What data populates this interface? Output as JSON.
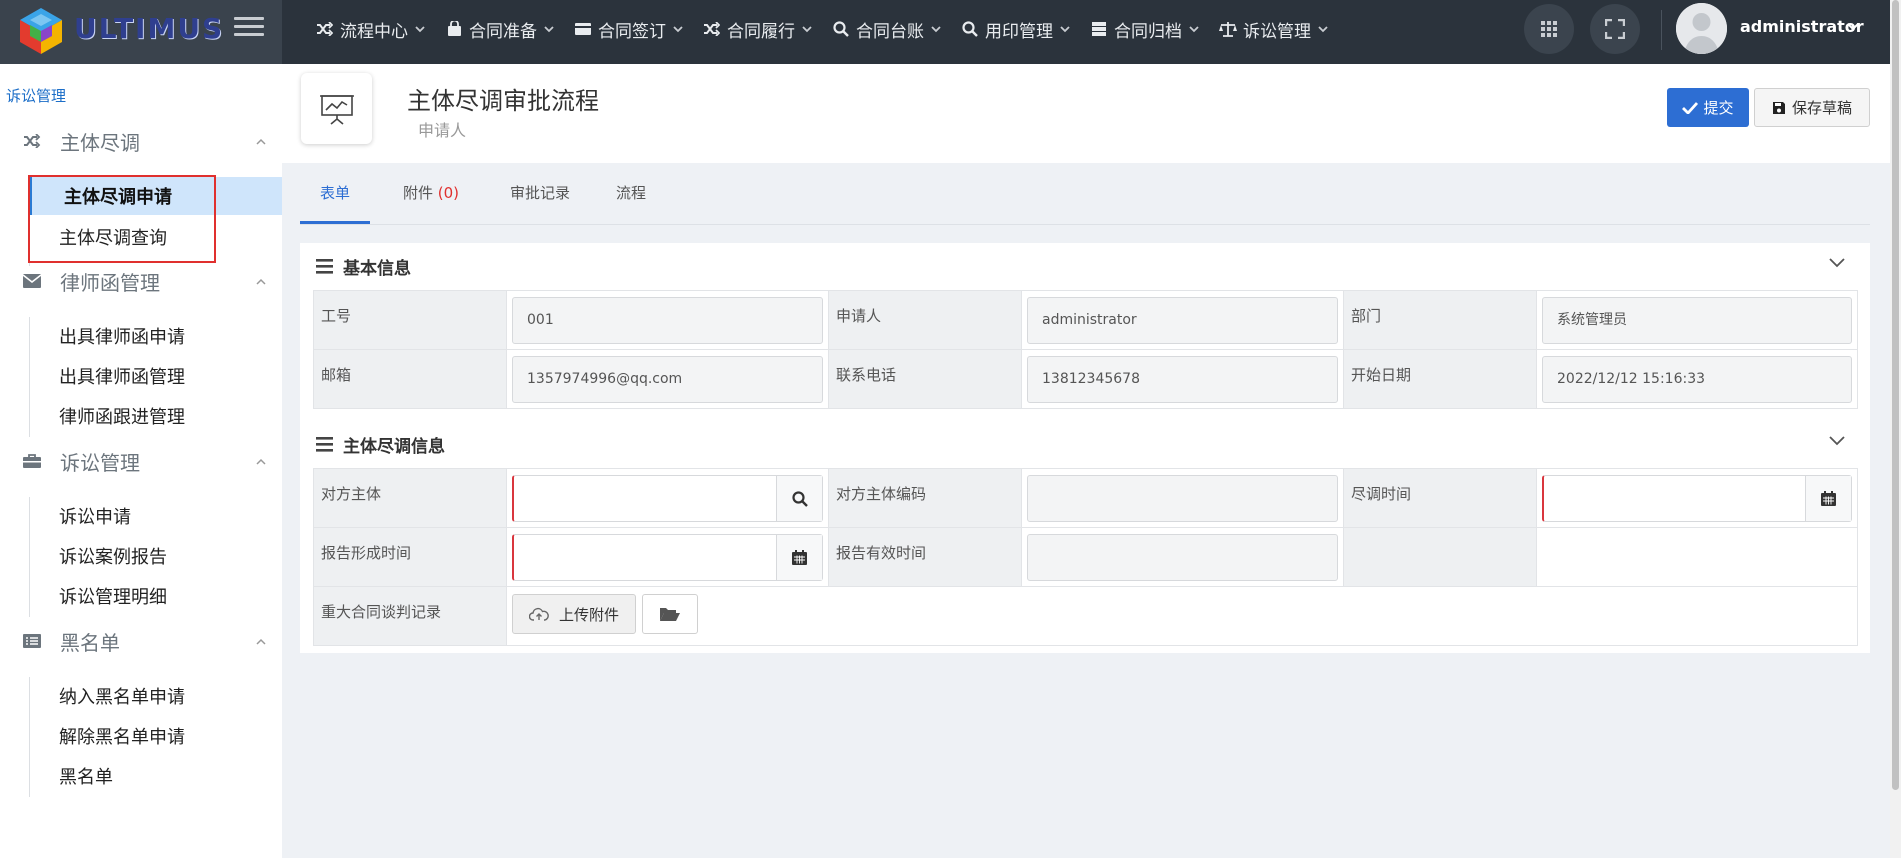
{
  "brand": {
    "name": "ULTIMUS"
  },
  "topnav": {
    "items": [
      {
        "label": "流程中心",
        "icon": "shuffle-icon"
      },
      {
        "label": "合同准备",
        "icon": "briefcase-icon"
      },
      {
        "label": "合同签订",
        "icon": "card-icon"
      },
      {
        "label": "合同履行",
        "icon": "shuffle-icon"
      },
      {
        "label": "合同台账",
        "icon": "search-icon"
      },
      {
        "label": "用印管理",
        "icon": "search-icon"
      },
      {
        "label": "合同归档",
        "icon": "server-icon"
      },
      {
        "label": "诉讼管理",
        "icon": "scale-icon"
      }
    ],
    "user": "administrator"
  },
  "sidebar": {
    "module_title": "诉讼管理",
    "groups": [
      {
        "label": "主体尽调",
        "icon": "shuffle-icon",
        "items": [
          "主体尽调申请",
          "主体尽调查询"
        ]
      },
      {
        "label": "律师函管理",
        "icon": "envelope-icon",
        "items": [
          "出具律师函申请",
          "出具律师函管理",
          "律师函跟进管理"
        ]
      },
      {
        "label": "诉讼管理",
        "icon": "briefcase-icon",
        "items": [
          "诉讼申请",
          "诉讼案例报告",
          "诉讼管理明细"
        ]
      },
      {
        "label": "黑名单",
        "icon": "list-icon",
        "items": [
          "纳入黑名单申请",
          "解除黑名单申请",
          "黑名单"
        ]
      }
    ],
    "active_item": "主体尽调申请"
  },
  "header": {
    "title": "主体尽调审批流程",
    "subtitle": "申请人",
    "submit_label": "提交",
    "draft_label": "保存草稿"
  },
  "tabs": {
    "form": "表单",
    "attachments": "附件",
    "attachments_count": "(0)",
    "records": "审批记录",
    "flow": "流程"
  },
  "basic_info": {
    "title": "基本信息",
    "fields": {
      "emp_no_label": "工号",
      "emp_no": "001",
      "applicant_label": "申请人",
      "applicant": "administrator",
      "dept_label": "部门",
      "dept": "系统管理员",
      "email_label": "邮箱",
      "email": "1357974996@qq.com",
      "phone_label": "联系电话",
      "phone": "13812345678",
      "start_label": "开始日期",
      "start": "2022/12/12 15:16:33"
    }
  },
  "dd_info": {
    "title": "主体尽调信息",
    "fields": {
      "party_label": "对方主体",
      "party_code_label": "对方主体编码",
      "dd_time_label": "尽调时间",
      "report_time_label": "报告形成时间",
      "report_valid_label": "报告有效时间",
      "negotiation_label": "重大合同谈判记录",
      "upload_label": "上传附件"
    }
  },
  "colors": {
    "primary": "#2d6ed3",
    "topbar": "#2b333c",
    "required": "#d9363e"
  }
}
